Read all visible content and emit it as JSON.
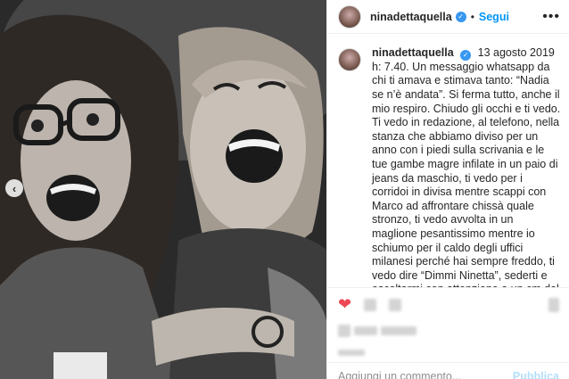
{
  "post": {
    "image_alt_icon": "photo-two-women-laughing",
    "carousel_prev_icon": "chevron-left-icon"
  },
  "header": {
    "username": "ninadettaquella",
    "separator": "•",
    "follow_label": "Segui",
    "more_icon": "more-horizontal-icon"
  },
  "caption": {
    "username": "ninadettaquella",
    "text": "13 agosto 2019 h: 7.40. Un messaggio whatsapp da chi ti amava e stimava tanto: “Nadia se n’è andata”. Si ferma tutto, anche il mio respiro. Chiudo gli occhi e ti vedo. Ti vedo in redazione, al telefono, nella stanza che abbiamo diviso per un anno con i piedi sulla scrivania e le tue gambe magre infilate in un paio di jeans da maschio, ti vedo per i corridoi in divisa mentre scappi con Marco ad affrontare chissà quale stronzo, ti vedo avvolta in un maglione pesantissimo mentre io schiumo per il caldo degli uffici milanesi perché hai sempre freddo, ti vedo dire “Dimmi Ninetta”, sederti e ascoltarmi con attenzione a un cm dal mio nasone mentre ti racconto di un possibile servizio “che"
  },
  "actions": {
    "like_icon": "heart-filled-icon"
  },
  "comment": {
    "placeholder": "Aggiungi un commento...",
    "publish_label": "Pubblica"
  },
  "colors": {
    "accent": "#0095f6",
    "verified": "#3897f0",
    "like": "#ed4956",
    "publish_disabled": "#b2dffc"
  }
}
